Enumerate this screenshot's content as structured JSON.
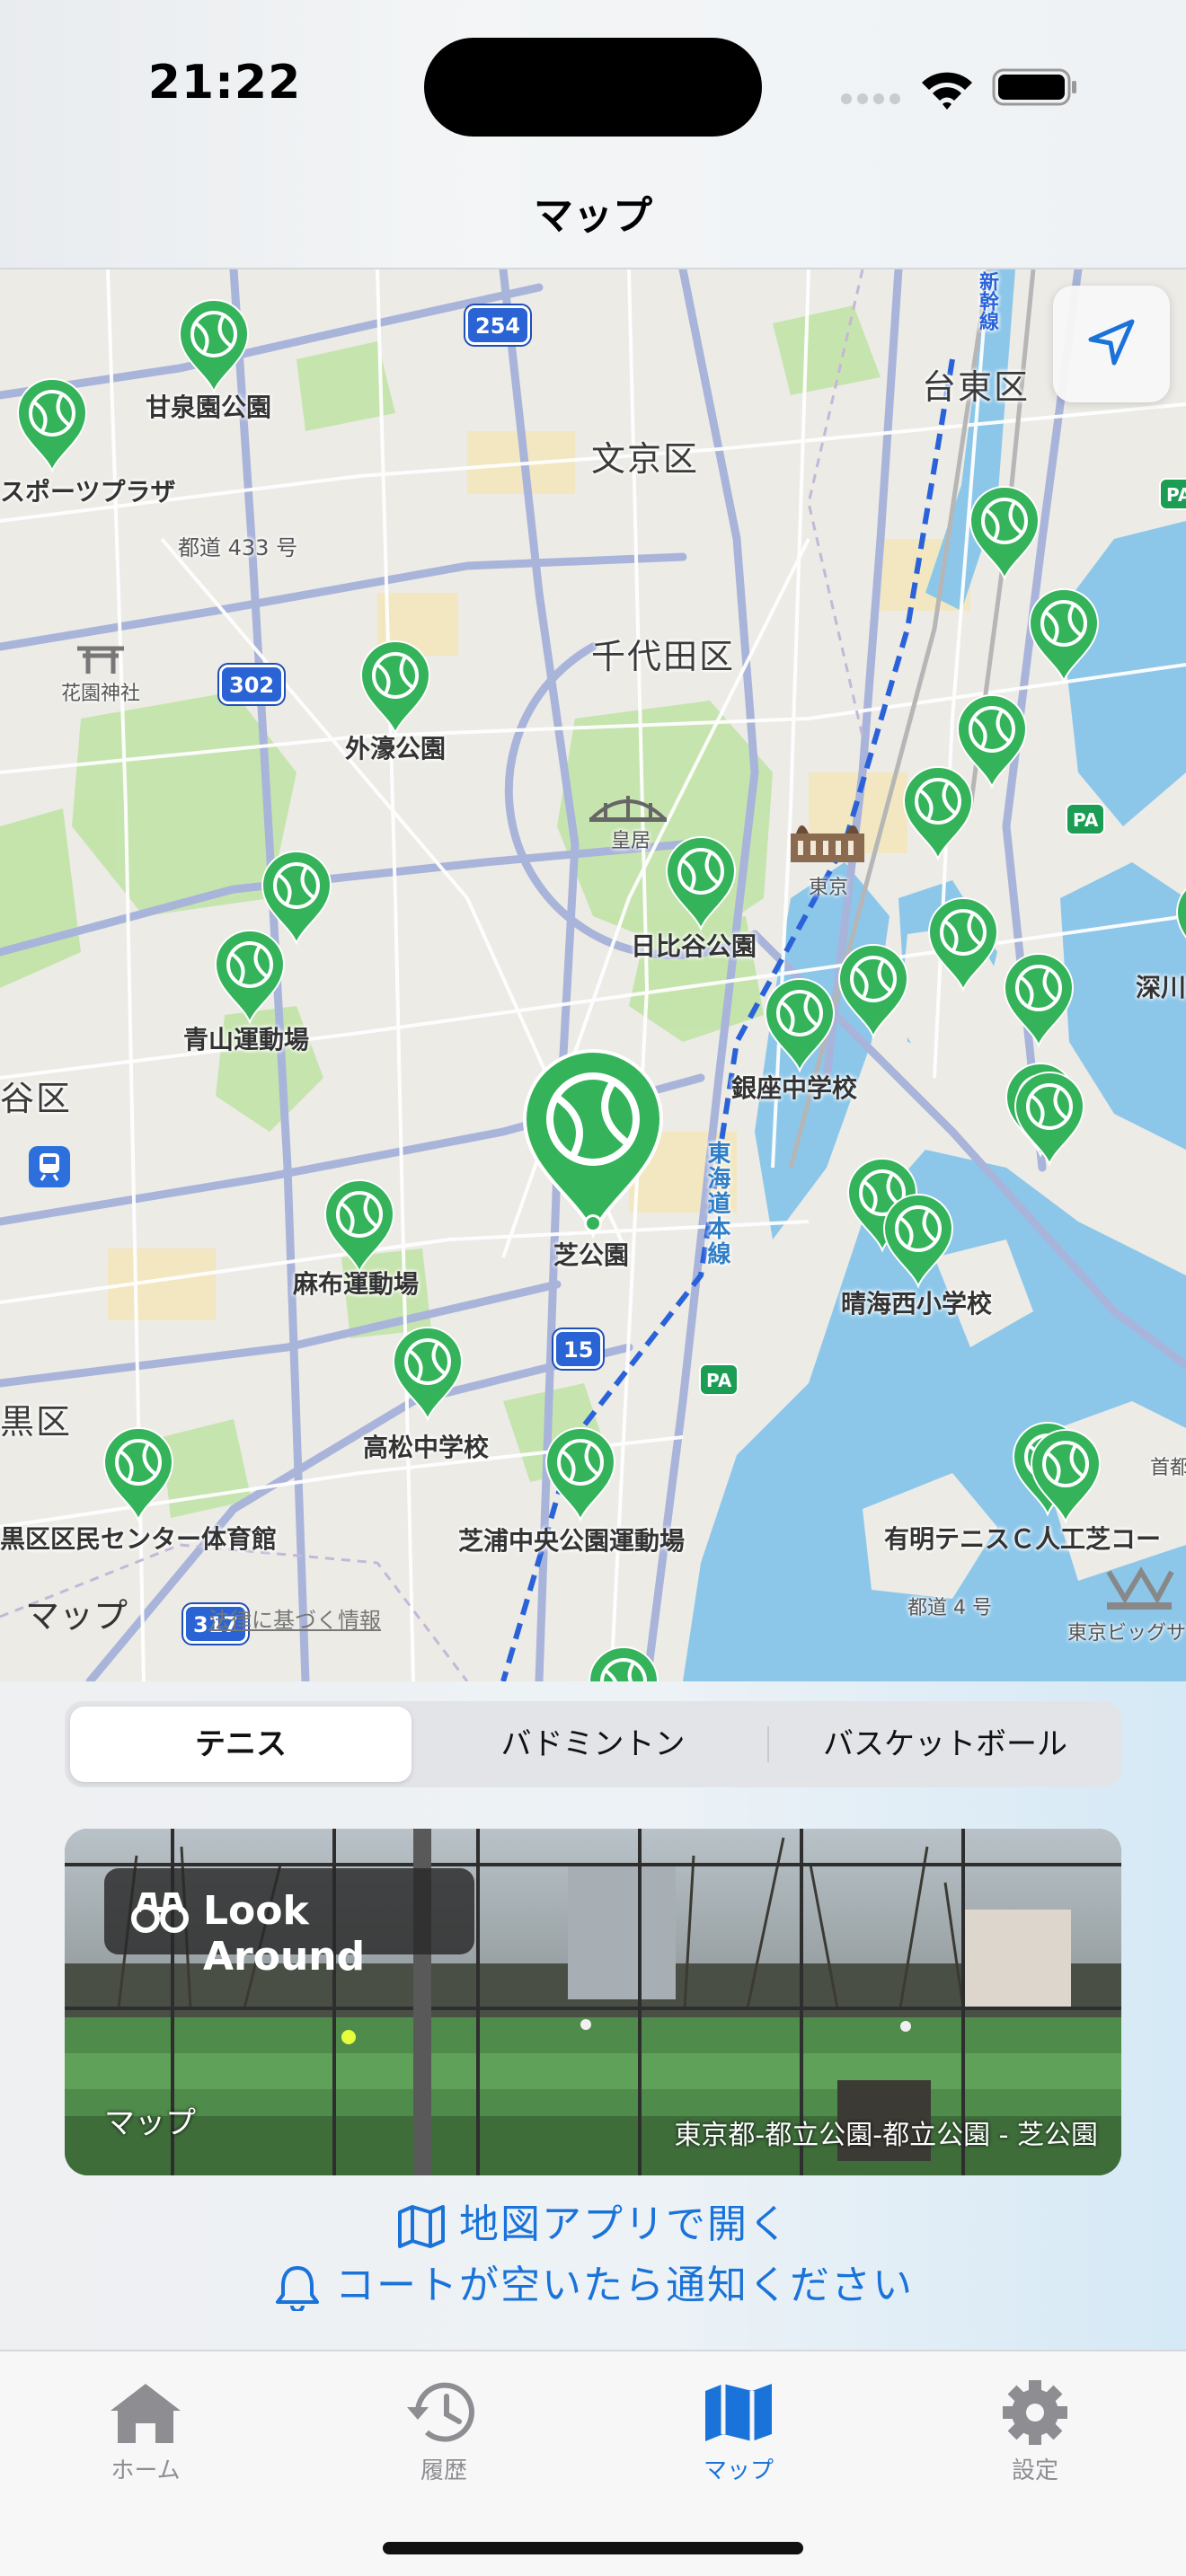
{
  "status_bar": {
    "time": "21:22"
  },
  "header": {
    "title": "マップ"
  },
  "map": {
    "labels": {
      "bunkyo": "文京区",
      "chiyoda": "千代田区",
      "taito": "台東区",
      "kanrien_park": "甘泉園公園",
      "sports_plaza": "スポーツプラザ",
      "toritsu_road_433": "都道 433 号",
      "hanazono_shrine": "花園神社",
      "gaien_park": "外濠公園",
      "imperial_palace": "皇居",
      "tokyo_station": "東京",
      "hibiya_park": "日比谷公園",
      "aoyama_field": "青山運動場",
      "shibuya_ward": "谷区",
      "ginza_school": "銀座中学校",
      "shiba_park": "芝公園",
      "tokaido_line": "東海道本線",
      "azabu_field": "麻布運動場",
      "harumi_school": "晴海西小学校",
      "takamatsu_school": "高松中学校",
      "meguro_ward": "黒区",
      "meguro_center": "黒区区民センター体育館",
      "shibaura_field": "芝浦中央公園運動場",
      "ariake_tennis": "有明テニスＣ人工芝コー",
      "fukagawa": "深川",
      "shinkansen": "新幹線",
      "big_sight": "東京ビッグサ",
      "road_4": "都道 4 号",
      "shuto": "首都"
    },
    "route_numbers": [
      "254",
      "302",
      "15",
      "317"
    ],
    "pa_label": "PA",
    "credit": "マップ",
    "legal": "法律に基づく情報",
    "selected_sport_icon": "tennis-ball-icon"
  },
  "sport_segments": {
    "items": [
      "テニス",
      "バドミントン",
      "バスケットボール"
    ],
    "selected": "テニス"
  },
  "look_around": {
    "badge": "Look Around",
    "credit": "マップ",
    "location": "東京都-都立公園-都立公園 - 芝公園"
  },
  "actions": {
    "open_maps": "地図アプリで開く",
    "notify": "コートが空いたら通知ください"
  },
  "tabbar": {
    "home": "ホーム",
    "history": "履歴",
    "map": "マップ",
    "settings": "設定",
    "active": "マップ"
  },
  "colors": {
    "accent": "#1a73d9",
    "pin_green": "#34b35a",
    "water": "#8cc7ea"
  }
}
